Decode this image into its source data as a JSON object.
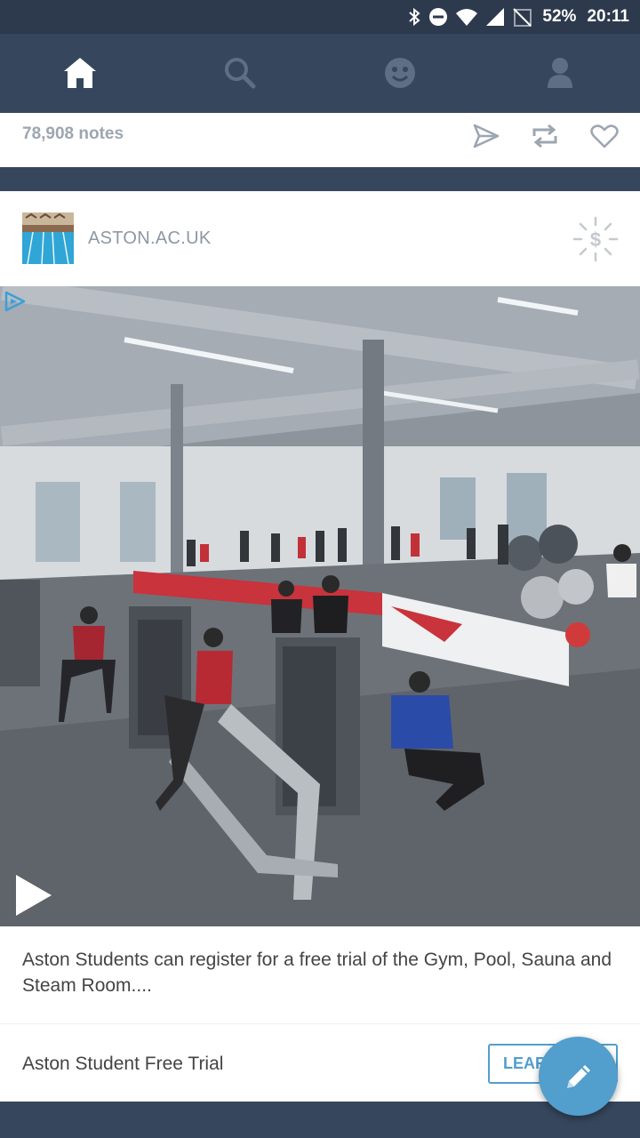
{
  "status_bar": {
    "battery": "52%",
    "time": "20:11",
    "icons": [
      "bluetooth-icon",
      "do-not-disturb-icon",
      "wifi-icon",
      "signal-icon",
      "no-sim-icon"
    ]
  },
  "nav": {
    "items": [
      {
        "icon": "home-icon",
        "active": true
      },
      {
        "icon": "search-icon",
        "active": false
      },
      {
        "icon": "explore-face-icon",
        "active": false
      },
      {
        "icon": "account-icon",
        "active": false
      }
    ]
  },
  "previous_post": {
    "notes": "78,908 notes",
    "actions": [
      "share-icon",
      "reblog-icon",
      "like-icon"
    ]
  },
  "ad_post": {
    "blog_name": "ASTON.AC.UK",
    "caption": "Aston Students can register for a free trial of the Gym, Pool, Sauna and Steam Room....",
    "cta_title": "Aston Student Free Trial",
    "cta_button": "LEARN MORE"
  },
  "colors": {
    "nav_background": "#36465d",
    "status_background": "#2d3a4d",
    "accent": "#529ecc"
  }
}
